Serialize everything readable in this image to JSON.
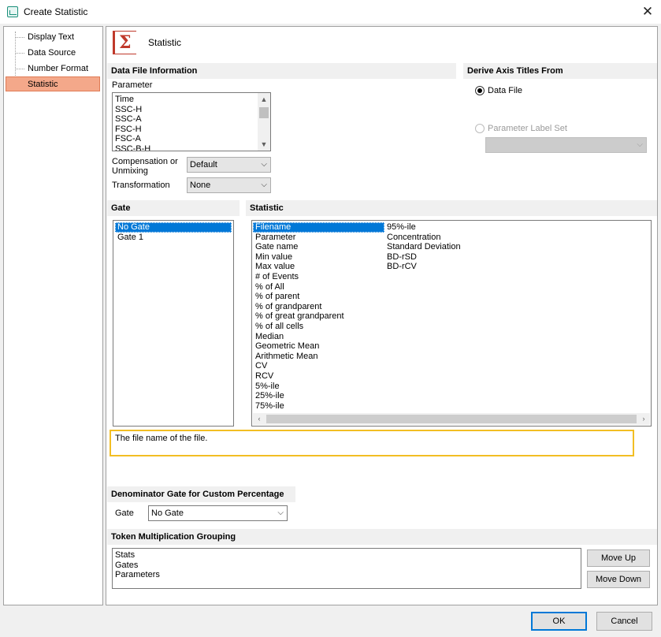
{
  "window": {
    "title": "Create Statistic"
  },
  "nav": {
    "items": [
      "Display Text",
      "Data Source",
      "Number Format",
      "Statistic"
    ],
    "selected": "Statistic"
  },
  "page": {
    "title": "Statistic"
  },
  "data_file_info": {
    "heading": "Data File Information",
    "parameter_label": "Parameter",
    "parameters": [
      "Time",
      "SSC-H",
      "SSC-A",
      "FSC-H",
      "FSC-A",
      "SSC-B-H"
    ],
    "compensation_label": "Compensation or\nUnmixing",
    "compensation_value": "Default",
    "transformation_label": "Transformation",
    "transformation_value": "None"
  },
  "derive": {
    "heading": "Derive Axis Titles From",
    "option_data_file": "Data File",
    "option_param_label_set": "Parameter Label Set"
  },
  "gate": {
    "heading": "Gate",
    "items": [
      "No Gate",
      "Gate 1"
    ],
    "selected": "No Gate"
  },
  "statistic": {
    "heading": "Statistic",
    "col1": [
      "Filename",
      "Parameter",
      "Gate name",
      "Min value",
      "Max value",
      "# of Events",
      "% of All",
      "% of parent",
      "% of grandparent",
      "% of great grandparent",
      "% of all cells",
      "Median",
      "Geometric Mean",
      "Arithmetic Mean",
      "CV",
      "RCV",
      "5%-ile",
      "25%-ile",
      "75%-ile"
    ],
    "col2": [
      "95%-ile",
      "Concentration",
      "Standard Deviation",
      "BD-rSD",
      "BD-rCV"
    ],
    "selected": "Filename"
  },
  "description": "The file name of the file.",
  "denominator": {
    "heading": "Denominator Gate for Custom Percentage",
    "gate_label": "Gate",
    "gate_value": "No Gate"
  },
  "token_grouping": {
    "heading": "Token Multiplication Grouping",
    "items": [
      "Stats",
      "Gates",
      "Parameters"
    ],
    "move_up": "Move Up",
    "move_down": "Move Down"
  },
  "buttons": {
    "ok": "OK",
    "cancel": "Cancel"
  },
  "colors": {
    "selection": "#0078d7",
    "nav_selected": "#f4a88a",
    "highlight_border": "#f2be23",
    "sigma": "#c0392b"
  }
}
